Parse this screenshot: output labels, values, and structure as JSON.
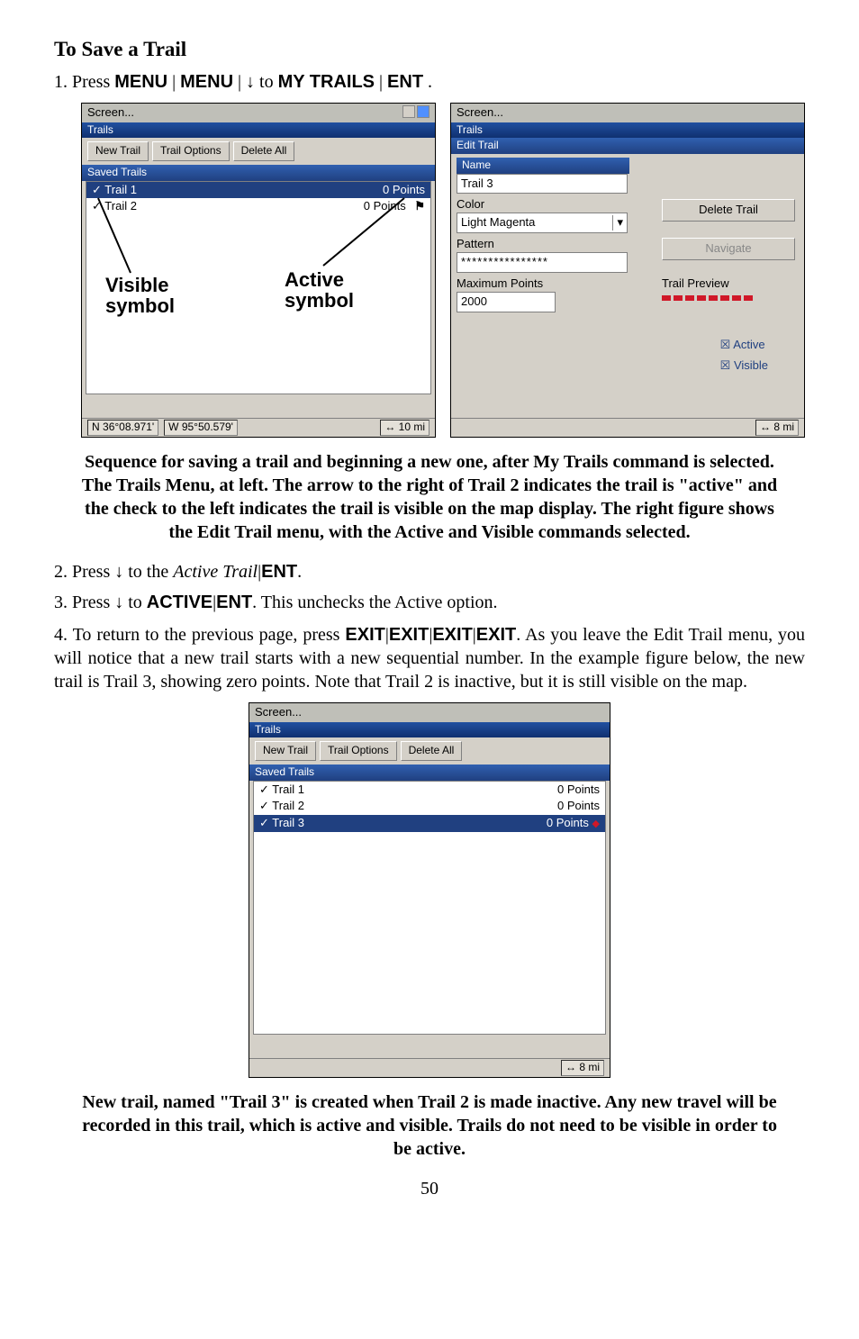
{
  "heading": {
    "title": "To Save a Trail"
  },
  "step1": {
    "prefix": "1. Press ",
    "k1": "MENU",
    "sep1": "|",
    "k2": "MENU",
    "sep2": "|",
    "arrow": "↓",
    "to": " to ",
    "k3": "MY TRAILS",
    "sep3": "|",
    "k4": "ENT",
    "dot": "."
  },
  "shotLeft": {
    "win": "Screen...",
    "trails": "Trails",
    "newTrail": "New Trail",
    "trailOptions": "Trail Options",
    "deleteAll": "Delete All",
    "saved": "Saved Trails",
    "t1": {
      "check": "✓",
      "name": "Trail 1",
      "pts": "0 Points"
    },
    "t2": {
      "check": "✓",
      "name": "Trail 2",
      "pts": "0 Points"
    },
    "annotVisible": "Visible\nsymbol",
    "annotActive": "Active\nsymbol",
    "status": {
      "n": "N",
      "lat": "36°08.971'",
      "w": "W",
      "lon": "95°50.579'",
      "arrow": "↔",
      "dist": "10 mi"
    }
  },
  "shotRight": {
    "win": "Screen...",
    "trails": "Trails",
    "edit": "Edit Trail",
    "nameLbl": "Name",
    "nameVal": "Trail 3",
    "deleteTrail": "Delete Trail",
    "colorLbl": "Color",
    "colorVal": "Light Magenta",
    "navigate": "Navigate",
    "patternLbl": "Pattern",
    "patternVal": "****************",
    "preview": "Trail Preview",
    "maxLbl": "Maximum Points",
    "maxVal": "2000",
    "chkActive": "☒ Active",
    "chkVisible": "☒ Visible",
    "status": {
      "arrow": "↔",
      "dist": "8 mi"
    }
  },
  "caption1": "Sequence for saving a trail and beginning a new one, after My Trails command is selected. The Trails Menu, at left. The arrow to the right of Trail 2 indicates the trail is \"active\" and the check to the left indicates the trail is visible on the map display. The right figure shows the Edit Trail menu, with the Active and Visible commands selected.",
  "step2": {
    "prefix": "2. Press ",
    "arrow": "↓",
    "mid": " to the ",
    "italic": "Active Trail",
    "sep": "|",
    "k": "ENT",
    "dot": "."
  },
  "step3": {
    "prefix": "3. Press ",
    "arrow": "↓",
    "mid": " to ",
    "k1": "ACTIVE",
    "sep": "|",
    "k2": "ENT",
    "tail": ". This unchecks the Active option."
  },
  "step4": {
    "prefix": "4. To return to the previous page, press ",
    "k": "EXIT",
    "sep": "|",
    "tail": ". As you leave the Edit Trail menu, you will notice that a new trail starts with a new sequential number. In the example figure below, the new trail is Trail 3, showing zero points. Note that Trail 2 is inactive, but it is still visible on the map."
  },
  "shotBottom": {
    "win": "Screen...",
    "trails": "Trails",
    "newTrail": "New Trail",
    "trailOptions": "Trail Options",
    "deleteAll": "Delete All",
    "saved": "Saved Trails",
    "t1": {
      "check": "✓",
      "name": "Trail 1",
      "pts": "0 Points"
    },
    "t2": {
      "check": "✓",
      "name": "Trail 2",
      "pts": "0 Points"
    },
    "t3": {
      "check": "✓",
      "name": "Trail 3",
      "pts": "0 Points"
    },
    "status": {
      "arrow": "↔",
      "dist": "8 mi"
    }
  },
  "caption2": "New trail, named \"Trail 3\" is created when Trail 2 is made inactive. Any new travel will be recorded in this trail, which is active and visible. Trails do not need to be visible in order to be active.",
  "page": "50"
}
